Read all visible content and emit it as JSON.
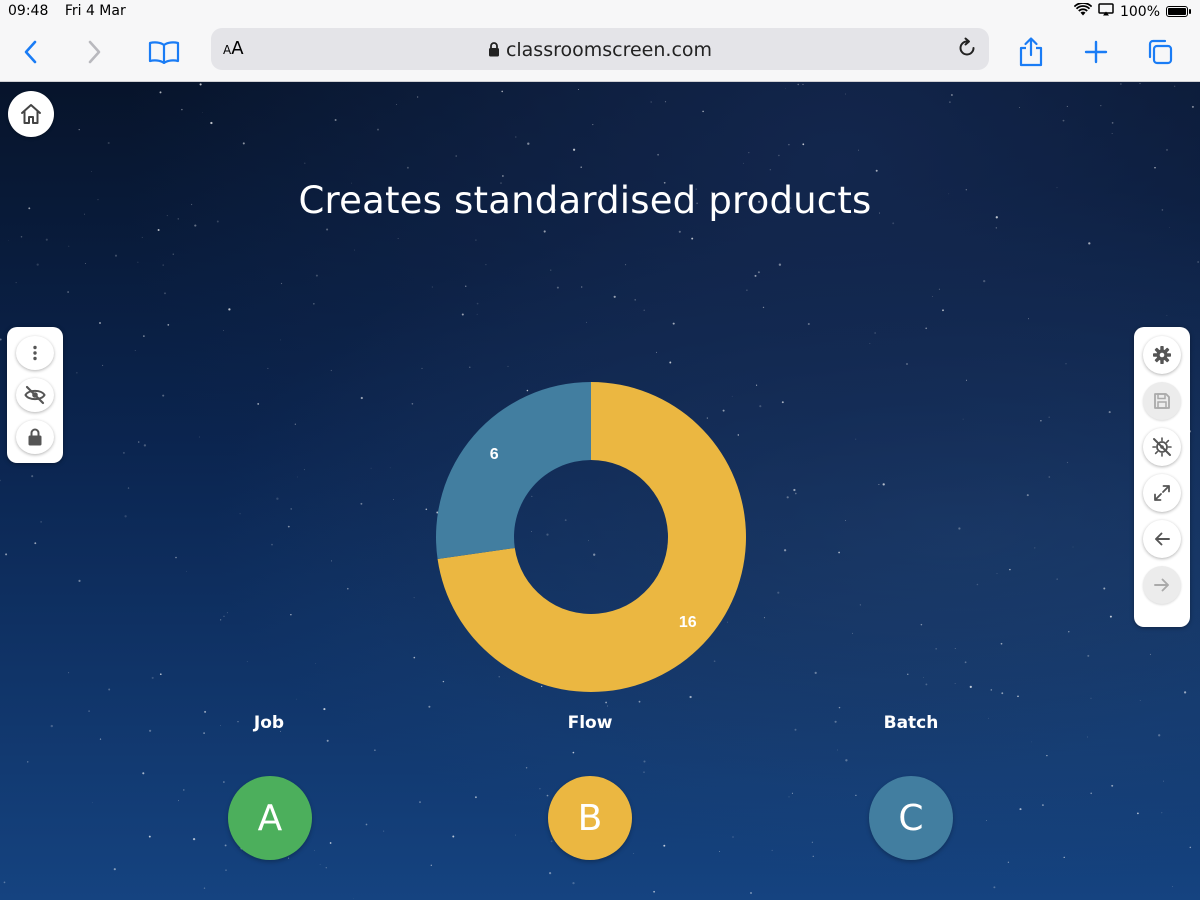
{
  "status_bar": {
    "time": "09:48",
    "date": "Fri 4 Mar",
    "battery": "100%",
    "battery_level": 1.0
  },
  "browser": {
    "text_size_label_small": "A",
    "text_size_label_large": "A",
    "url": "classroomscreen.com",
    "icons": {
      "back": "chevron-left-icon",
      "forward": "chevron-right-icon",
      "bookmarks": "book-icon",
      "reload": "reload-icon",
      "share": "share-icon",
      "new_tab": "plus-icon",
      "tabs": "tabs-icon",
      "lock": "lock-icon"
    },
    "colors": {
      "accent": "#1a7cf5"
    }
  },
  "poll": {
    "question": "Creates standardised products",
    "options": [
      {
        "letter": "A",
        "label": "Job",
        "color": "#4caf5c"
      },
      {
        "letter": "B",
        "label": "Flow",
        "color": "#ebb741"
      },
      {
        "letter": "C",
        "label": "Batch",
        "color": "#427ea0"
      }
    ]
  },
  "left_panel": {
    "icons": [
      "more-vertical-icon",
      "eye-off-icon",
      "lock-icon"
    ]
  },
  "right_panel": {
    "icons": [
      "gear-icon",
      "save-icon",
      "no-camera-icon",
      "expand-icon",
      "arrow-left-icon",
      "arrow-right-icon"
    ]
  },
  "chart_data": {
    "type": "pie",
    "subtype": "donut",
    "categories": [
      "Job",
      "Flow",
      "Batch"
    ],
    "values": [
      0,
      16,
      6
    ],
    "colors": [
      "#4caf5c",
      "#ebb741",
      "#427ea0"
    ],
    "data_labels": [
      "",
      "16",
      "6"
    ]
  }
}
